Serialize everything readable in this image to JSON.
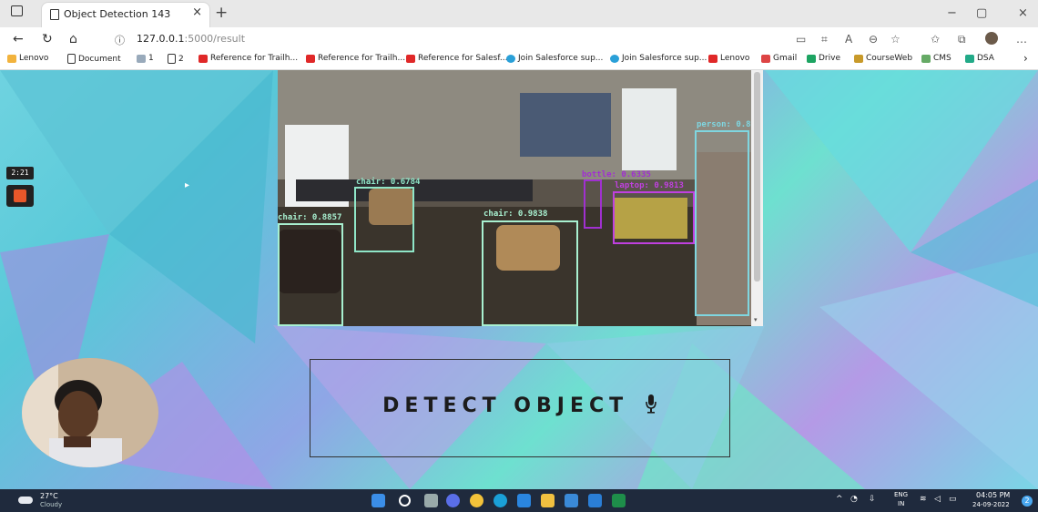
{
  "browser": {
    "tab_title": "Object Detection 143",
    "tab_close": "×",
    "new_tab": "+",
    "url_host": "127.0.0.1",
    "url_path": ":5000/result",
    "window_controls": [
      "−",
      "▢",
      "×"
    ]
  },
  "bookmarks": [
    {
      "label": "Lenovo",
      "color": "#f2b33d"
    },
    {
      "label": "Document",
      "color": "#ffffff"
    },
    {
      "label": "1",
      "color": "#9ab"
    },
    {
      "label": "2",
      "color": "#ffffff"
    },
    {
      "label": "Reference for Trailh...",
      "color": "#e02828"
    },
    {
      "label": "Reference for Trailh...",
      "color": "#e02828"
    },
    {
      "label": "Reference for Salesf...",
      "color": "#e02828"
    },
    {
      "label": "Join Salesforce sup...",
      "color": "#2aa0d8"
    },
    {
      "label": "Join Salesforce sup...",
      "color": "#2aa0d8"
    },
    {
      "label": "Lenovo",
      "color": "#e02828"
    },
    {
      "label": "Gmail",
      "color": "#d44"
    },
    {
      "label": "Drive",
      "color": "#1da462"
    },
    {
      "label": "CourseWeb",
      "color": "#c89a2a"
    },
    {
      "label": "CMS",
      "color": "#6a6"
    },
    {
      "label": "DSA",
      "color": "#2a8"
    }
  ],
  "detections": [
    {
      "label": "person: 0.8",
      "color": "#7fd6e0"
    },
    {
      "label": "chair: 0.6784",
      "color": "#8fe6c8"
    },
    {
      "label": "chair: 0.8857",
      "color": "#a8f0d0"
    },
    {
      "label": "chair: 0.9838",
      "color": "#a8f0d0"
    },
    {
      "label": "laptop: 0.9813",
      "color": "#c040e0"
    },
    {
      "label": "bottle: 0.6335",
      "color": "#a030d0"
    }
  ],
  "main": {
    "detect_button_label": "DETECT OBJECT"
  },
  "recorder": {
    "timer": "2:21"
  },
  "taskbar": {
    "weather_temp": "27°C",
    "weather_desc": "Cloudy",
    "lang_top": "ENG",
    "lang_bottom": "IN",
    "time": "04:05 PM",
    "date": "24-09-2022",
    "notif_count": "2"
  }
}
